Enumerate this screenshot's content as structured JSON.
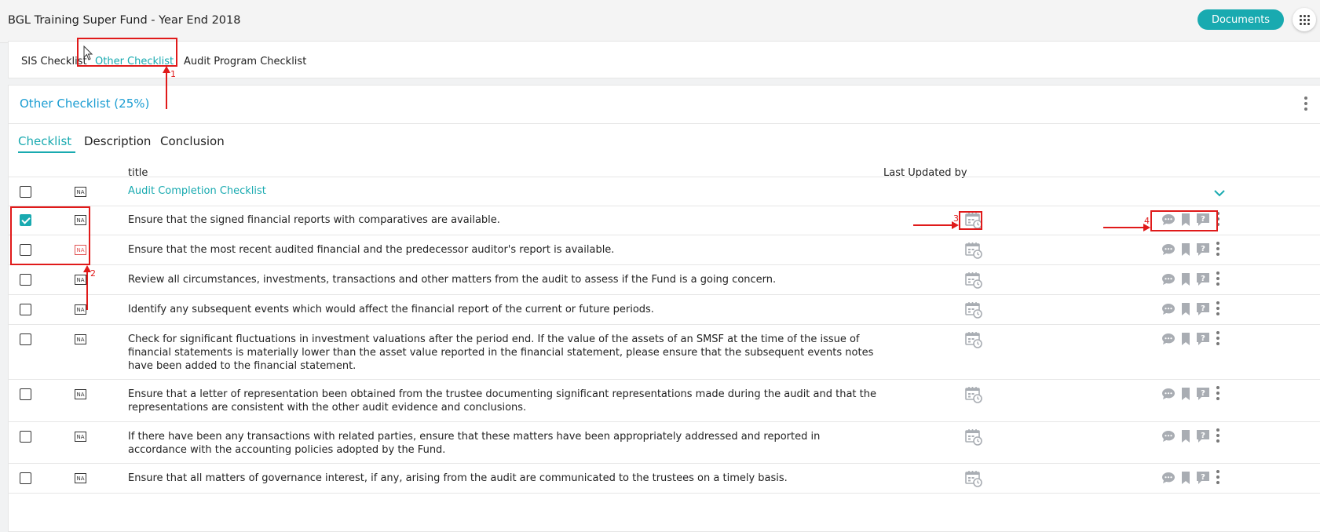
{
  "header": {
    "title": "BGL Training Super Fund - Year End 2018",
    "documents_label": "Documents"
  },
  "top_tabs": [
    {
      "label": "SIS Checklist"
    },
    {
      "label": "Other Checklist"
    },
    {
      "label": "Audit Program Checklist"
    }
  ],
  "card": {
    "title": "Other Checklist (25%)"
  },
  "sub_tabs": [
    {
      "label": "Checklist"
    },
    {
      "label": "Description"
    },
    {
      "label": "Conclusion"
    }
  ],
  "table": {
    "col_title": "title",
    "col_updated": "Last Updated by",
    "group": {
      "na": "NA",
      "title": "Audit Completion Checklist"
    },
    "rows": [
      {
        "na": "NA",
        "checked": true,
        "text": "Ensure that the signed financial reports with comparatives are available."
      },
      {
        "na": "NA",
        "checked": false,
        "text": "Ensure that the most recent audited financial and the predecessor auditor's report is available."
      },
      {
        "na": "NA",
        "checked": false,
        "text": "Review all circumstances, investments, transactions and other matters from the audit to assess if the Fund is a going concern."
      },
      {
        "na": "NA",
        "checked": false,
        "text": "Identify any subsequent events which would affect the financial report of the current or future periods."
      },
      {
        "na": "NA",
        "checked": false,
        "text": "Check for significant fluctuations in investment valuations after the period end. If the value of the assets of an SMSF at the time of the issue of financial statements is materially lower than the asset value reported in the financial statement, please ensure that the subsequent events notes have been added to the financial statement."
      },
      {
        "na": "NA",
        "checked": false,
        "text": "Ensure that a letter of representation been obtained from the trustee documenting significant representations made during the audit and that the representations are consistent with the other audit evidence and conclusions."
      },
      {
        "na": "NA",
        "checked": false,
        "text": "If there have been any transactions with related parties, ensure that these matters have been appropriately addressed and reported in accordance with the accounting policies adopted by the Fund."
      },
      {
        "na": "NA",
        "checked": false,
        "text": "Ensure that all matters of governance interest, if any, arising from the audit are communicated to the trustees on a timely basis."
      }
    ]
  },
  "annotations": [
    "1",
    "2",
    "3",
    "4"
  ],
  "colors": {
    "accent": "#19aab0",
    "title_blue": "#1b9dd2",
    "annotation": "#e01a1a",
    "icon_gray": "#a9adb3"
  }
}
